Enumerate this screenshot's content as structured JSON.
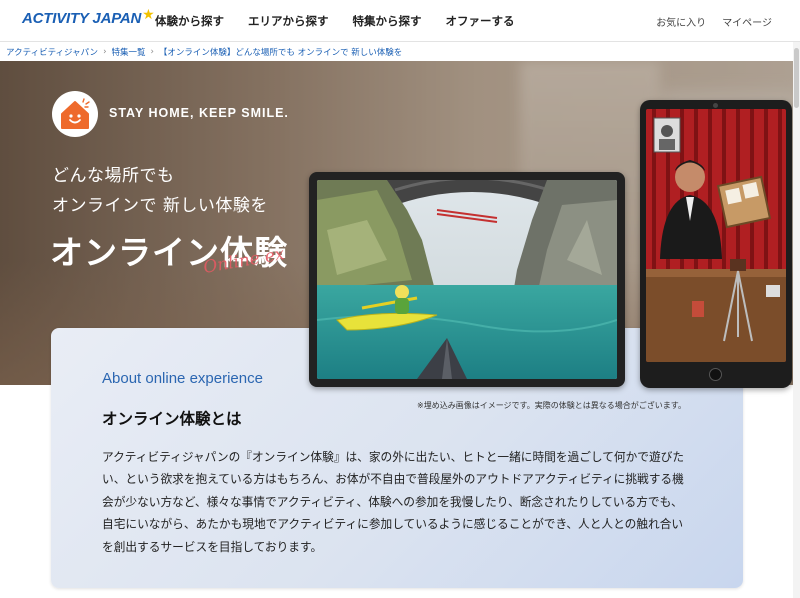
{
  "header": {
    "logo_text": "ACTIVITY JAPAN",
    "nav": [
      "体験から探す",
      "エリアから探す",
      "特集から探す",
      "オファーする"
    ],
    "user_nav": [
      "お気に入り",
      "マイページ"
    ]
  },
  "breadcrumb": [
    "アクティビティジャパン",
    "特集一覧",
    "【オンライン体験】どんな場所でも オンラインで 新しい体験を"
  ],
  "hero": {
    "tagline": "STAY HOME, KEEP SMILE.",
    "subtitle_line1": "どんな場所でも",
    "subtitle_line2": "オンラインで 新しい体験を",
    "title": "オンライン体験",
    "script_text": "Online ex"
  },
  "about": {
    "heading_en": "About online experience",
    "heading_jp": "オンライン体験とは",
    "note": "※埋め込み画像はイメージです。実際の体験とは異なる場合がございます。",
    "body": "アクティビティジャパンの『オンライン体験』は、家の外に出たい、ヒトと一緒に時間を過ごして何かで遊びたい、という欲求を抱えている方はもちろん、お体が不自由で普段屋外のアウトドアアクティビティに挑戦する機会が少ない方など、様々な事情でアクティビティ、体験への参加を我慢したり、断念されたりしている方でも、自宅にいながら、あたかも現地でアクティビティに参加しているように感じることができ、人と人との触れ合いを創出するサービスを目指しております。"
  },
  "colors": {
    "brand_blue": "#1a5fb4",
    "logo_star": "#f2c200",
    "badge_orange": "#ee6a2c",
    "script_red": "#e35a63"
  },
  "icons": {
    "badge": "house-smile-icon",
    "logo": "star-icon"
  }
}
